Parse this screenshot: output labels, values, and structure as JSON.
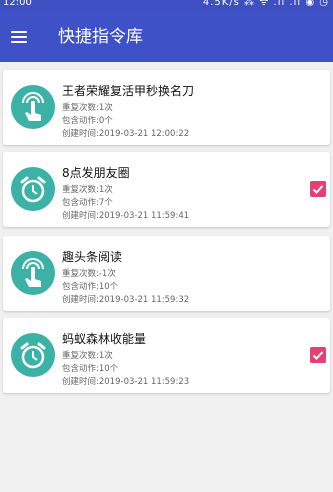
{
  "status_bar": {
    "time": "12:00",
    "right": "4.5K/s ⁂ ᯤ .ıl .ıl ◉ ◷"
  },
  "app_bar": {
    "title": "快捷指令库"
  },
  "cards": [
    {
      "icon": "touch-hand-icon",
      "title": "王者荣耀复活甲秒换名刀",
      "repeat": "重复次数:1次",
      "actions": "包含动作:0个",
      "created": "创建时间:2019-03-21 12:00:22",
      "checked": false
    },
    {
      "icon": "alarm-clock-icon",
      "title": "8点发朋友圈",
      "repeat": "重复次数:1次",
      "actions": "包含动作:7个",
      "created": "创建时间:2019-03-21 11:59:41",
      "checked": true
    },
    {
      "icon": "touch-hand-icon",
      "title": "趣头条阅读",
      "repeat": "重复次数:-1次",
      "actions": "包含动作:10个",
      "created": "创建时间:2019-03-21 11:59:32",
      "checked": false
    },
    {
      "icon": "alarm-clock-icon",
      "title": "蚂蚁森林收能量",
      "repeat": "重复次数:1次",
      "actions": "包含动作:10个",
      "created": "创建时间:2019-03-21 11:59:23",
      "checked": true
    }
  ],
  "colors": {
    "primary": "#3f51c6",
    "avatar": "#3bb2a5",
    "checkbox": "#e53f73"
  }
}
